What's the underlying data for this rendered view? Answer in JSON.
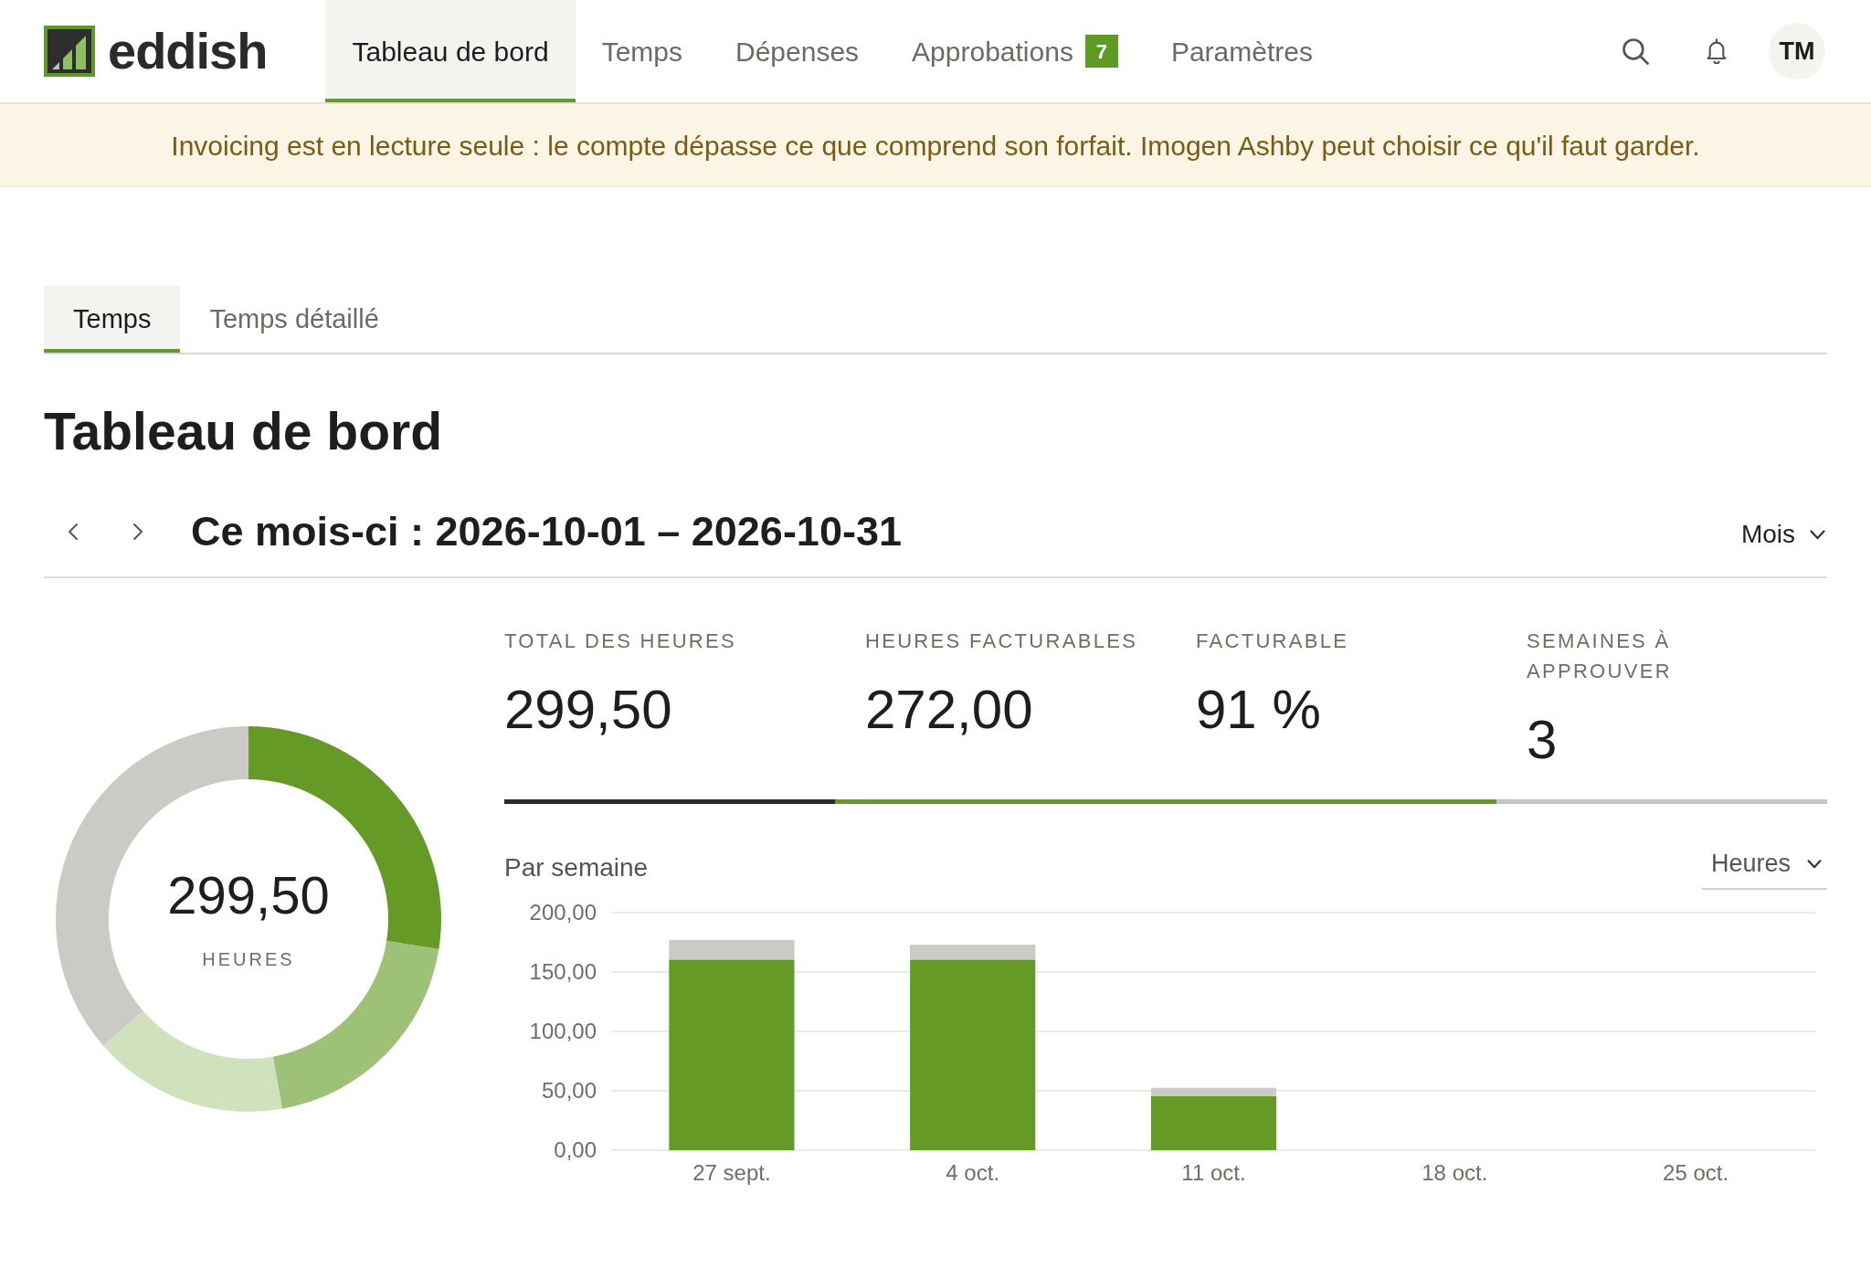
{
  "brand": {
    "name": "eddish"
  },
  "nav": {
    "items": [
      {
        "label": "Tableau de bord",
        "selected": true
      },
      {
        "label": "Temps",
        "selected": false
      },
      {
        "label": "Dépenses",
        "selected": false
      },
      {
        "label": "Approbations",
        "selected": false,
        "badge": "7"
      },
      {
        "label": "Paramètres",
        "selected": false
      }
    ]
  },
  "user": {
    "initials": "TM"
  },
  "banner": {
    "text": "Invoicing est en lecture seule : le compte dépasse ce que comprend son forfait. Imogen Ashby peut choisir ce qu'il faut garder."
  },
  "tabs": [
    {
      "label": "Temps",
      "selected": true
    },
    {
      "label": "Temps détaillé",
      "selected": false
    }
  ],
  "title": "Tableau de bord",
  "period": {
    "label": "Ce mois-ci : 2026-10-01 – 2026-10-31",
    "granularity": "Mois"
  },
  "donut": {
    "center_value": "299,50",
    "center_label": "HEURES",
    "chart_data": {
      "type": "donut",
      "values": [
        27.5,
        19.7,
        16.4,
        36.4
      ]
    }
  },
  "stats": [
    {
      "label": "TOTAL DES HEURES",
      "value": "299,50",
      "color": "#2b2b2b"
    },
    {
      "label": "HEURES FACTURABLES",
      "value": "272,00",
      "color": "#659a26"
    },
    {
      "label": "FACTURABLE",
      "value": "91 %",
      "color": "#659a26"
    },
    {
      "label": "SEMAINES À APPROUVER",
      "value": "3",
      "color": "#c4c4c0"
    }
  ],
  "weekly": {
    "title": "Par semaine",
    "metric": "Heures",
    "chart_data": {
      "type": "bar",
      "categories": [
        "27 sept.",
        "4 oct.",
        "11 oct.",
        "18 oct.",
        "25 oct."
      ],
      "series": [
        {
          "color": "#659a26",
          "values": [
            160.5,
            160.5,
            45.5,
            0,
            0
          ]
        },
        {
          "color": "#cbcac4",
          "values": [
            16.5,
            12.5,
            7,
            0,
            0
          ]
        }
      ],
      "stacked": true,
      "grid": true,
      "ylim": [
        0,
        200
      ],
      "yticks": [
        {
          "value": 0,
          "label": "0,00"
        },
        {
          "value": 50,
          "label": "50,00"
        },
        {
          "value": 100,
          "label": "100,00"
        },
        {
          "value": 150,
          "label": "150,00"
        },
        {
          "value": 200,
          "label": "200,00"
        }
      ]
    }
  }
}
